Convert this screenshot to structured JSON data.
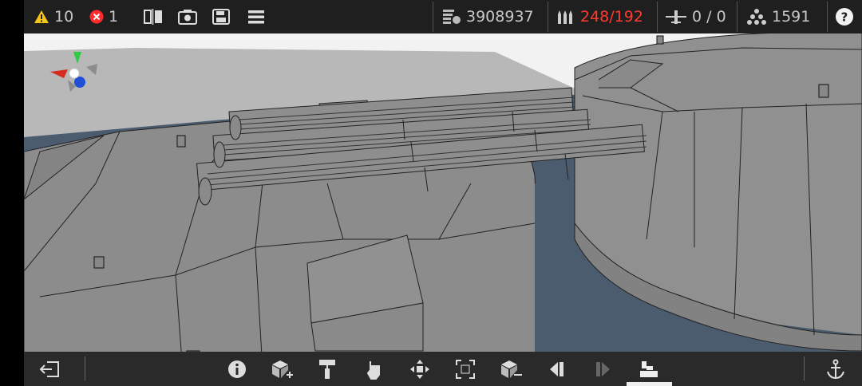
{
  "topbar": {
    "warnings_count": "10",
    "errors_count": "1",
    "weight_value": "3908937",
    "ammo_value": "248/192",
    "aircraft_value": "0 / 0",
    "crew_value": "1591"
  },
  "icons": {
    "warning": "warning-triangle-icon",
    "error": "error-x-icon",
    "mirror": "mirror-icon",
    "screenshot": "camera-icon",
    "save": "save-icon",
    "menu": "menu-icon",
    "weight": "weight-icon",
    "ammo": "ammo-icon",
    "aircraft": "aircraft-icon",
    "crew": "crew-icon",
    "help": "help-icon"
  },
  "colors": {
    "ammo_over_limit": "#ff3b30",
    "bar_background": "#1f1f1f",
    "sky": "#f2f2f2",
    "water": "#4a5b6d",
    "hull": "#8a8a8a"
  },
  "bottombar": {
    "buttons": [
      "exit-icon",
      "info-icon",
      "add-part-icon",
      "paint-roller-icon",
      "hand-select-icon",
      "move-icon",
      "scale-icon",
      "remove-part-icon",
      "previous-icon",
      "next-icon",
      "parts-category-icon",
      "anchor-icon"
    ],
    "active": "parts-category-icon"
  }
}
